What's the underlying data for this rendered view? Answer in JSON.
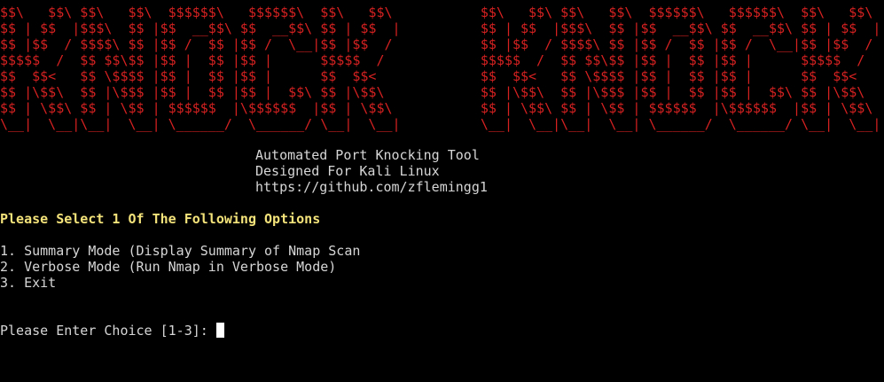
{
  "banner": {
    "lines": [
      "$$\\   $$\\ $$\\   $$\\  $$$$$$\\   $$$$$$\\  $$\\   $$\\           $$\\   $$\\ $$\\   $$\\  $$$$$$\\   $$$$$$\\  $$\\   $$\\",
      "$$ | $$  |$$$\\  $$ |$$  __$$\\ $$  __$$\\ $$ | $$  |          $$ | $$  |$$$\\  $$ |$$  __$$\\ $$  __$$\\ $$ | $$  |",
      "$$ |$$  / $$$$\\ $$ |$$ /  $$ |$$ /  \\__|$$ |$$  /           $$ |$$  / $$$$\\ $$ |$$ /  $$ |$$ /  \\__|$$ |$$  /",
      "$$$$$  /  $$ $$\\$$ |$$ |  $$ |$$ |      $$$$$  /            $$$$$  /  $$ $$\\$$ |$$ |  $$ |$$ |      $$$$$  /",
      "$$  $$<   $$ \\$$$$ |$$ |  $$ |$$ |      $$  $$<             $$  $$<   $$ \\$$$$ |$$ |  $$ |$$ |      $$  $$<",
      "$$ |\\$$\\  $$ |\\$$$ |$$ |  $$ |$$ |  $$\\ $$ |\\$$\\            $$ |\\$$\\  $$ |\\$$$ |$$ |  $$ |$$ |  $$\\ $$ |\\$$\\",
      "$$ | \\$$\\ $$ | \\$$ | $$$$$$  |\\$$$$$$  |$$ | \\$$\\           $$ | \\$$\\ $$ | \\$$ | $$$$$$  |\\$$$$$$  |$$ | \\$$\\",
      "\\__|  \\__|\\__|  \\__| \\______/  \\______/ \\__|  \\__|          \\__|  \\__|\\__|  \\__| \\______/  \\______/ \\__|  \\__|"
    ]
  },
  "info": {
    "title": "Automated Port Knocking Tool",
    "platform": "Designed For Kali Linux",
    "url": "https://github.com/zflemingg1"
  },
  "menu": {
    "heading": "Please Select 1 Of The Following Options",
    "options": [
      "1. Summary Mode (Display Summary of Nmap Scan",
      "2. Verbose Mode (Run Nmap in Verbose Mode)",
      "3. Exit"
    ]
  },
  "prompt": {
    "label": "Please Enter Choice [1-3]: ",
    "value": ""
  },
  "colors": {
    "banner": "#d62121",
    "heading": "#f4e37a",
    "text": "#d6d6d6",
    "background": "#000000",
    "cursor": "#ffffff"
  }
}
